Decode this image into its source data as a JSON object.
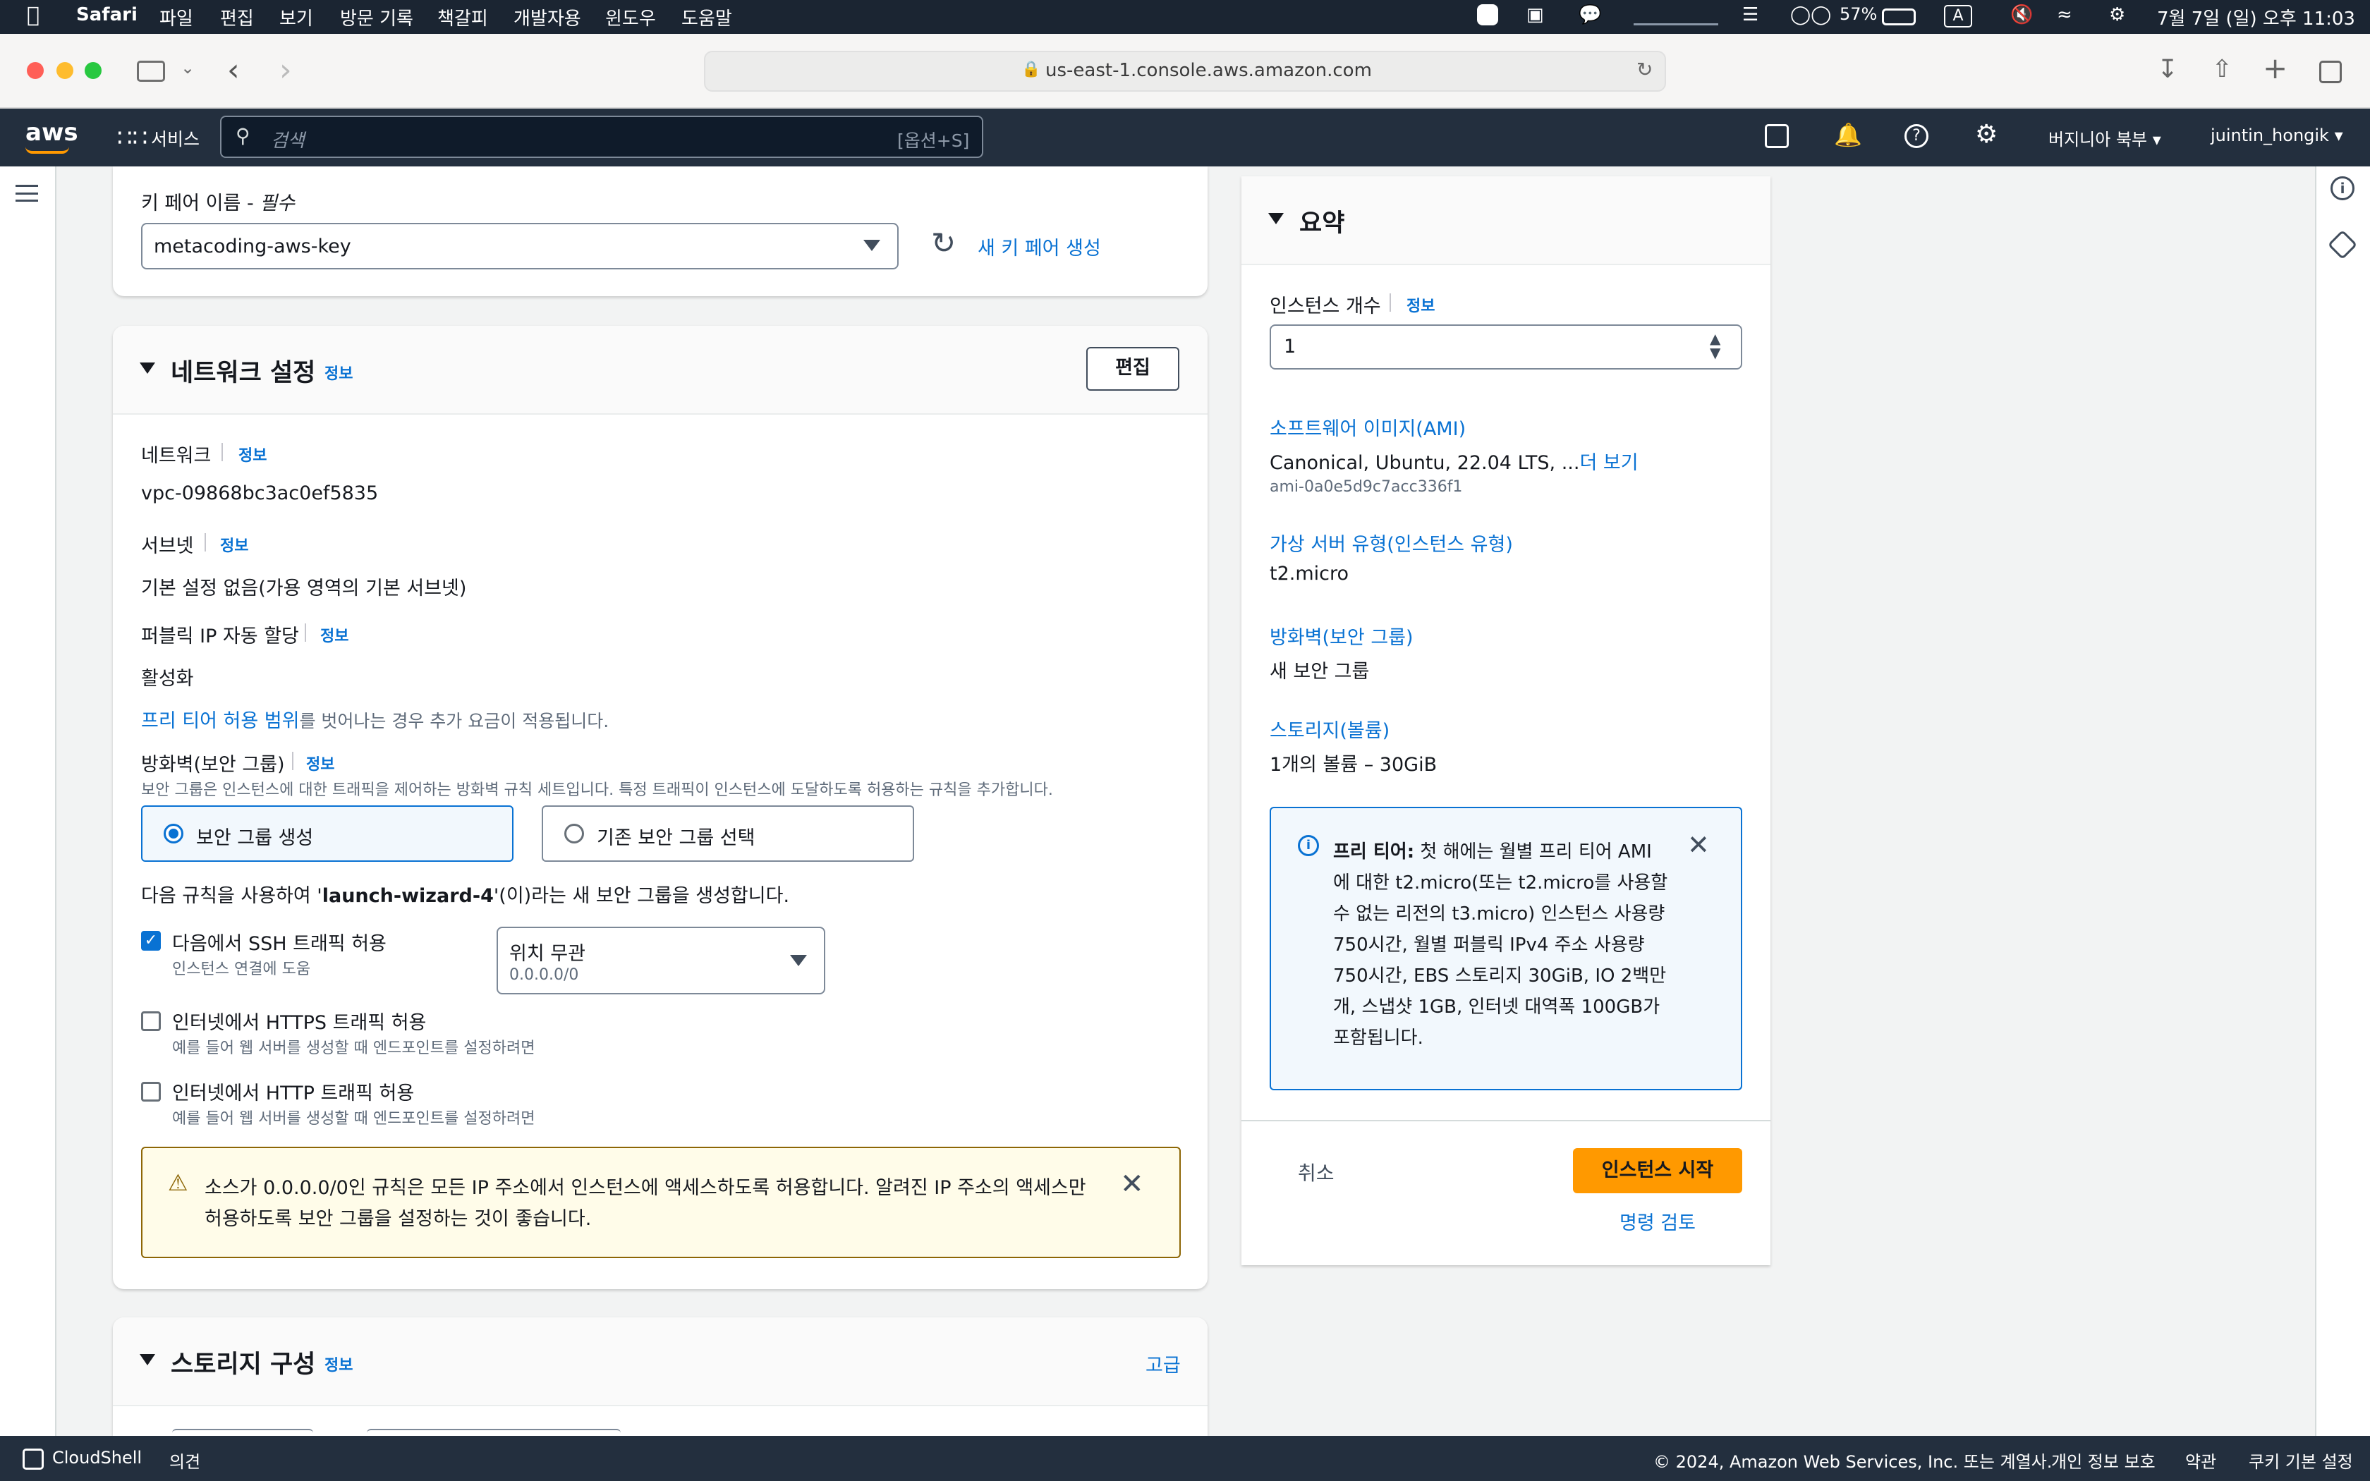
{
  "macos_menu": {
    "app": "Safari",
    "items": [
      "파일",
      "편집",
      "보기",
      "방문 기록",
      "책갈피",
      "개발자용",
      "윈도우",
      "도움말"
    ],
    "battery": "57%",
    "input": "A",
    "datetime": "7월 7일 (일) 오후 11:03"
  },
  "browser": {
    "url": "us-east-1.console.aws.amazon.com"
  },
  "aws_header": {
    "logo": "aws",
    "services": "서비스",
    "search_placeholder": "검색",
    "search_shortcut": "[옵션+S]",
    "region": "버지니아 북부",
    "user": "juintin_hongik"
  },
  "keypair": {
    "label": "키 페어 이름 - ",
    "required": "필수",
    "value": "metacoding-aws-key",
    "create_link": "새 키 페어 생성"
  },
  "network": {
    "title": "네트워크 설정",
    "info": "정보",
    "edit": "편집",
    "network_label": "네트워크",
    "network_value": "vpc-09868bc3ac0ef5835",
    "subnet_label": "서브넷",
    "subnet_value": "기본 설정 없음(가용 영역의 기본 서브넷)",
    "public_ip_label": "퍼블릭 IP 자동 할당",
    "public_ip_value": "활성화",
    "free_tier_link": "프리 티어 허용 범위",
    "free_tier_note": "를 벗어나는 경우 추가 요금이 적용됩니다.",
    "firewall_label": "방화벽(보안 그룹)",
    "firewall_desc": "보안 그룹은 인스턴스에 대한 트래픽을 제어하는 방화벽 규칙 세트입니다. 특정 트래픽이 인스턴스에 도달하도록 허용하는 규칙을 추가합니다.",
    "radio_create": "보안 그룹 생성",
    "radio_existing": "기존 보안 그룹 선택",
    "rule_pre": "다음 규칙을 사용하여 '",
    "rule_name": "launch-wizard-4",
    "rule_post": "'(이)라는 새 보안 그룹을 생성합니다.",
    "ssh_label": "다음에서 SSH 트래픽 허용",
    "ssh_sub": "인스턴스 연결에 도움",
    "ssh_src_title": "위치 무관",
    "ssh_src_value": "0.0.0.0/0",
    "https_label": "인터넷에서 HTTPS 트래픽 허용",
    "https_sub": "예를 들어 웹 서버를 생성할 때 엔드포인트를 설정하려면",
    "http_label": "인터넷에서 HTTP 트래픽 허용",
    "http_sub": "예를 들어 웹 서버를 생성할 때 엔드포인트를 설정하려면",
    "warning_line1": "소스가 0.0.0.0/0인 규칙은 모든 IP 주소에서 인스턴스에 액세스하도록 허용합니다. 알려진 IP 주소의 액세스만",
    "warning_line2": "허용하도록 보안 그룹을 설정하는 것이 좋습니다."
  },
  "storage": {
    "title": "스토리지 구성",
    "info": "정보",
    "advanced": "고급"
  },
  "summary": {
    "title": "요약",
    "count_label": "인스턴스 개수",
    "count_info": "정보",
    "count_value": "1",
    "ami_label": "소프트웨어 이미지(AMI)",
    "ami_value": "Canonical, Ubuntu, 22.04 LTS, ...",
    "ami_more": "더 보기",
    "ami_id": "ami-0a0e5d9c7acc336f1",
    "type_label": "가상 서버 유형(인스턴스 유형)",
    "type_value": "t2.micro",
    "fw_label": "방화벽(보안 그룹)",
    "fw_value": "새 보안 그룹",
    "storage_label": "스토리지(볼륨)",
    "storage_value": "1개의 볼륨 – 30GiB",
    "free_title": "프리 티어:",
    "free_lines": [
      " 첫 해에는 월별 프리 티어 AMI",
      "에 대한 t2.micro(또는 t2.micro를 사용할",
      "수 없는 리전의 t3.micro) 인스턴스 사용량",
      "750시간, 월별 퍼블릭 IPv4 주소 사용량",
      "750시간, EBS 스토리지 30GiB, IO 2백만",
      "개, 스냅샷 1GB, 인터넷 대역폭 100GB가",
      "포함됩니다."
    ],
    "cancel": "취소",
    "launch": "인스턴스 시작",
    "review": "명령 검토"
  },
  "footer": {
    "cloudshell": "CloudShell",
    "feedback": "의견",
    "copyright": "© 2024, Amazon Web Services, Inc. 또는 계열사.",
    "privacy": "개인 정보 보호",
    "terms": "약관",
    "cookies": "쿠키 기본 설정"
  },
  "colors": {
    "aws_dark": "#232f3e",
    "link": "#0972d3",
    "launch_orange": "#ff9900",
    "info_bg": "#f2f8fd",
    "warn_bg": "#fffce9"
  }
}
